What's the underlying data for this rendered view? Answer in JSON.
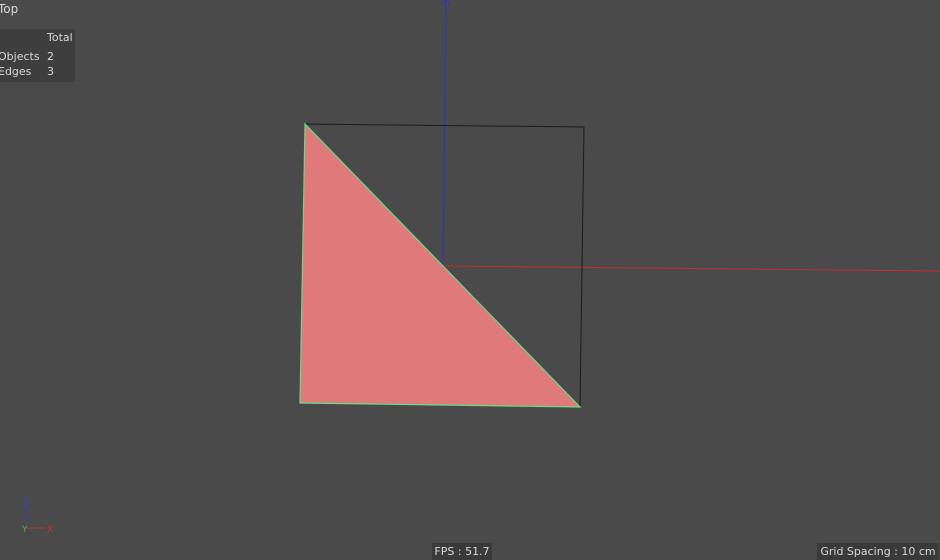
{
  "viewport": {
    "view_name": "Top",
    "stats": {
      "column_header": "Total",
      "rows": [
        {
          "label": "Objects",
          "value": "2"
        },
        {
          "label": "Edges",
          "value": "3"
        }
      ]
    },
    "fps_text": "FPS : 51.7",
    "grid_spacing_text": "Grid Spacing : 10 cm"
  },
  "gizmo": {
    "z_label": "Z",
    "y_label": "Y",
    "x_label": "X"
  },
  "colors": {
    "background": "#4a4a4a",
    "triangle_fill": "#e07a7a",
    "triangle_edge": "#66dd88",
    "x_axis": "#c03030",
    "z_axis": "#3030c8",
    "gizmo_y": "#40c040"
  }
}
